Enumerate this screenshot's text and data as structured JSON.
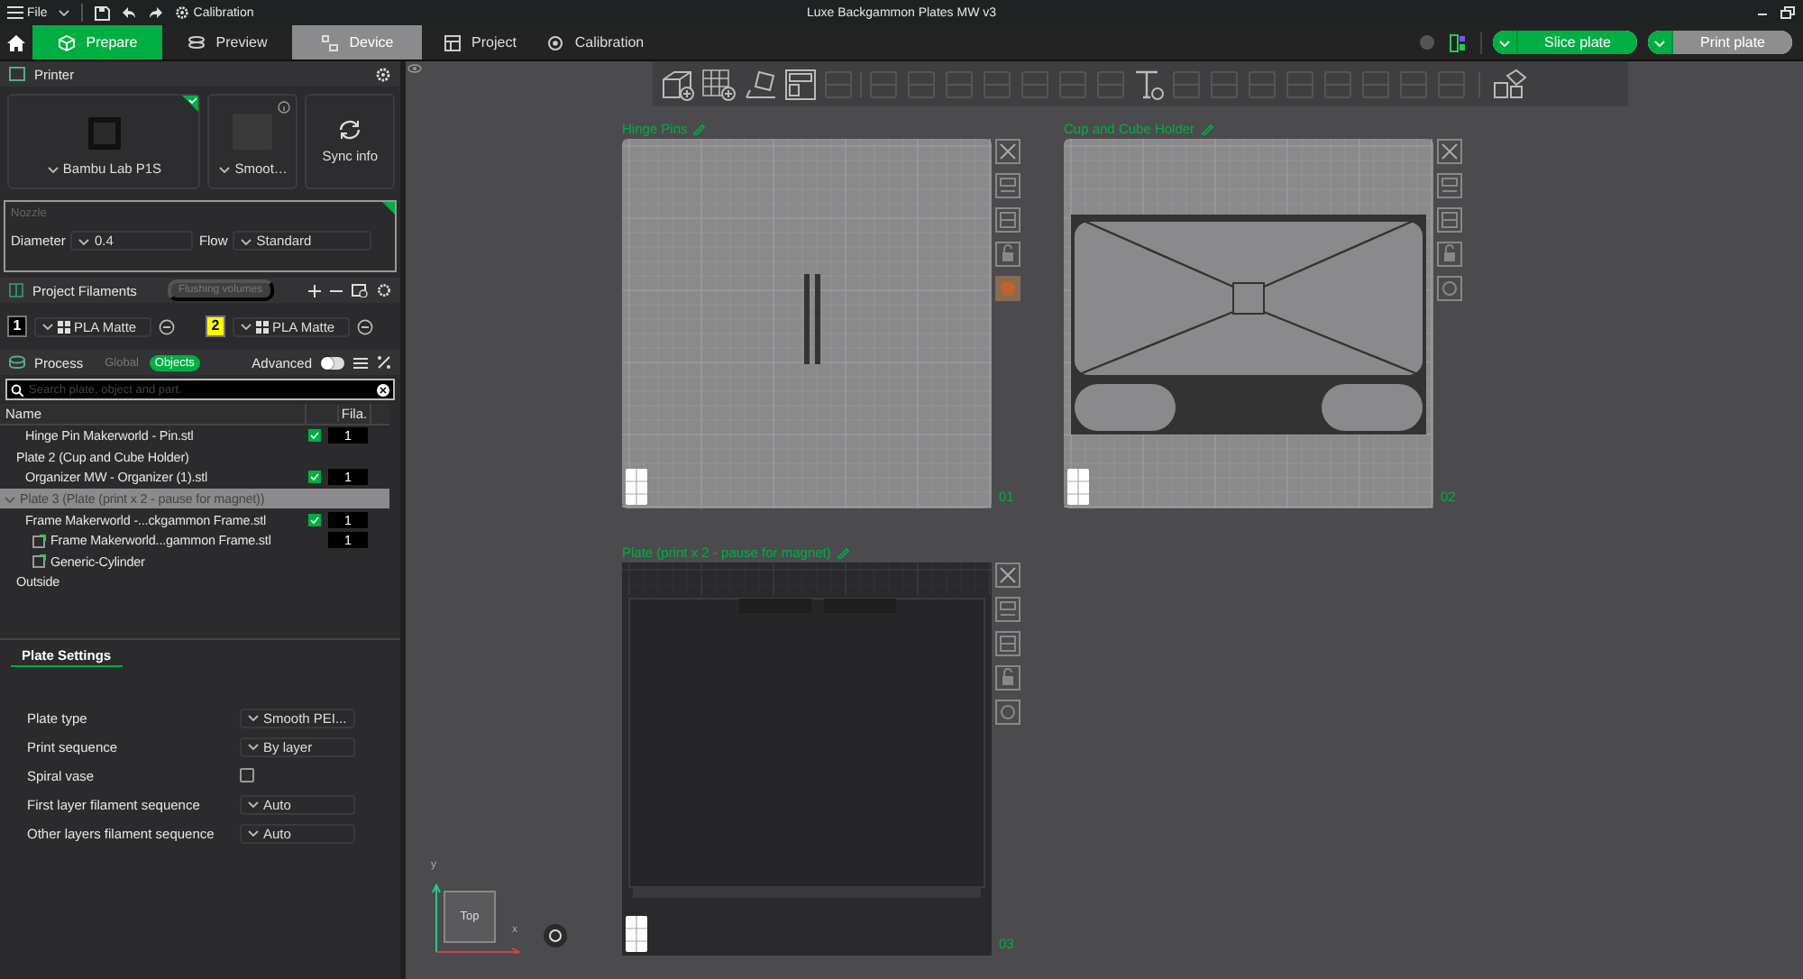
{
  "menu": {
    "file": "File",
    "calibration": "Calibration"
  },
  "window_title": "Luxe Backgammon Plates MW v3",
  "tabs": [
    {
      "label": "Prepare",
      "selected": true,
      "hovered": false
    },
    {
      "label": "Preview",
      "selected": false,
      "hovered": false
    },
    {
      "label": "Device",
      "selected": false,
      "hovered": true
    },
    {
      "label": "Project",
      "selected": false,
      "hovered": false
    },
    {
      "label": "Calibration",
      "selected": false,
      "hovered": false
    }
  ],
  "actions": [
    {
      "label": "Slice plate",
      "kind": "primary"
    },
    {
      "label": "Print plate",
      "kind": "secondary"
    }
  ],
  "printer": {
    "title": "Printer",
    "name": "Bambu Lab P1S",
    "plate": "Smoot…",
    "sync": "Sync info"
  },
  "nozzle": {
    "title": "Nozzle",
    "diameter_label": "Diameter",
    "diameter": "0.4",
    "flow_label": "Flow",
    "flow": "Standard"
  },
  "filaments": {
    "title": "Project Filaments",
    "flushing": "Flushing volumes",
    "items": [
      {
        "index": "1",
        "name": "PLA Matte",
        "color": "#000000"
      },
      {
        "index": "2",
        "name": "PLA Matte",
        "color": "#ffff00"
      }
    ]
  },
  "process": {
    "title": "Process",
    "modes": [
      {
        "label": "Global",
        "selected": false
      },
      {
        "label": "Objects",
        "selected": true
      }
    ],
    "advanced_label": "Advanced",
    "advanced": false,
    "search_placeholder": "Search plate, object and part."
  },
  "objects": {
    "columns": [
      "Name",
      "Fila."
    ],
    "rows": [
      {
        "kind": "object",
        "name": "Hinge Pin Makerworld - Pin.stl",
        "checked": true,
        "filament": "1",
        "selected": false
      },
      {
        "kind": "plate",
        "name": "Plate 2 (Cup and Cube Holder)",
        "selected": false,
        "children": [
          {
            "kind": "object",
            "name": "Organizer MW - Organizer (1).stl",
            "checked": true,
            "filament": "1",
            "selected": false
          }
        ]
      },
      {
        "kind": "plate",
        "name": "Plate 3 (Plate (print x 2 - pause for magnet))",
        "selected": true,
        "children": [
          {
            "kind": "object",
            "name": "Frame Makerworld -...ckgammon Frame.stl",
            "checked": true,
            "filament": "1",
            "selected": false,
            "children": [
              {
                "kind": "part",
                "name": "Frame Makerworld...gammon Frame.stl",
                "filament": "1",
                "selected": false
              },
              {
                "kind": "part",
                "name": "Generic-Cylinder",
                "selected": false
              }
            ]
          }
        ]
      },
      {
        "kind": "plate",
        "name": "Outside",
        "selected": false
      }
    ]
  },
  "plate_settings": {
    "title": "Plate Settings",
    "rows": [
      {
        "label": "Plate type",
        "kind": "select",
        "value": "Smooth PEI..."
      },
      {
        "label": "Print sequence",
        "kind": "select",
        "value": "By layer"
      },
      {
        "label": "Spiral vase",
        "kind": "checkbox",
        "checked": false
      },
      {
        "label": "First layer filament sequence",
        "kind": "select",
        "value": "Auto"
      },
      {
        "label": "Other layers filament sequence",
        "kind": "select",
        "value": "Auto"
      }
    ]
  },
  "plates": [
    {
      "name": "Hinge Pins",
      "number": "01",
      "kind": "pins",
      "custom_settings": true
    },
    {
      "name": "Cup and Cube Holder",
      "number": "02",
      "kind": "tray",
      "custom_settings": false
    },
    {
      "name": "Plate (print x 2 - pause for magnet)",
      "number": "03",
      "kind": "board",
      "custom_settings": false
    }
  ],
  "view": {
    "cube": "Top",
    "y_axis": "y",
    "x_axis": "x"
  }
}
